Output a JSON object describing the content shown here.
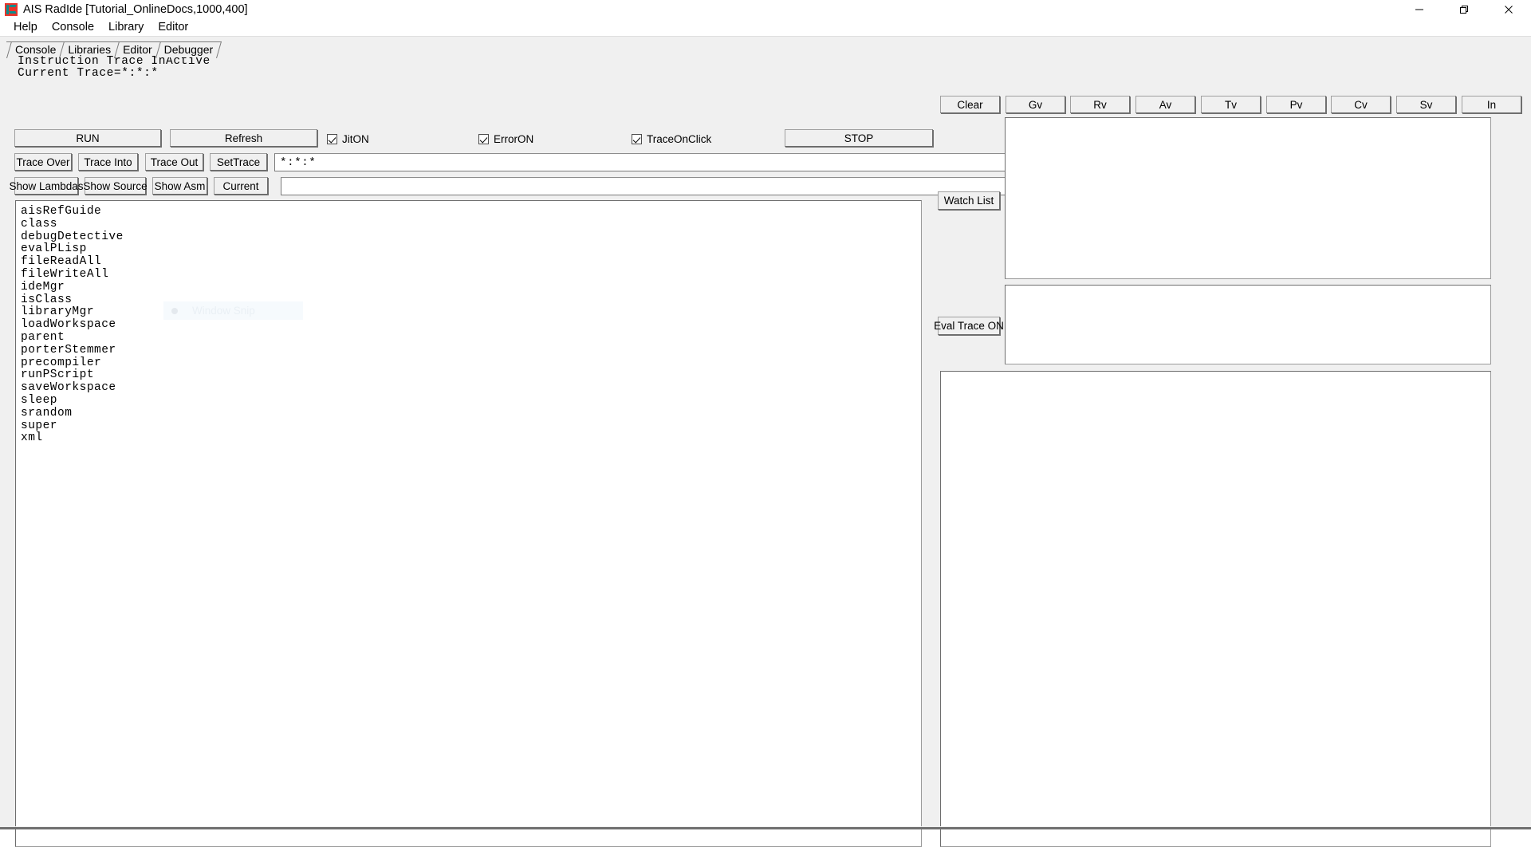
{
  "window": {
    "title": "AIS RadIde [Tutorial_OnlineDocs,1000,400]",
    "icon": "app-icon",
    "controls": {
      "minimize": "minimize-icon",
      "maximize": "maximize-icon",
      "close": "close-icon"
    }
  },
  "menubar": {
    "items": [
      {
        "label": "Help"
      },
      {
        "label": "Console"
      },
      {
        "label": "Library"
      },
      {
        "label": "Editor"
      }
    ]
  },
  "tabs": [
    {
      "label": "Console",
      "active": false
    },
    {
      "label": "Libraries",
      "active": false
    },
    {
      "label": "Editor",
      "active": false
    },
    {
      "label": "Debugger",
      "active": true
    }
  ],
  "status": {
    "trace_state": "Instruction Trace InActive",
    "current_trace": "Current Trace=*:*:*"
  },
  "toolbar_row1": {
    "run_label": "RUN",
    "refresh_label": "Refresh",
    "stop_label": "STOP",
    "checkboxes": [
      {
        "label": "JitON",
        "checked": true
      },
      {
        "label": "ErrorON",
        "checked": true
      },
      {
        "label": "TraceOnClick",
        "checked": true
      }
    ]
  },
  "toolbar_row2": {
    "trace_over_label": "Trace Over",
    "trace_into_label": "Trace Into",
    "trace_out_label": "Trace Out",
    "set_trace_label": "SetTrace",
    "trace_field_value": "*:*:*",
    "trace_field_placeholder": ""
  },
  "toolbar_row3": {
    "show_lambdas_label": "Show Lambdas",
    "show_source_label": "Show Source",
    "show_asm_label": "Show Asm",
    "current_label": "Current",
    "command_field_value": "",
    "command_field_placeholder": ""
  },
  "list_panel": {
    "items": [
      "aisRefGuide",
      "class",
      "debugDetective",
      "evalPLisp",
      "fileReadAll",
      "fileWriteAll",
      "ideMgr",
      "isClass",
      "libraryMgr",
      "loadWorkspace",
      "parent",
      "porterStemmer",
      "precompiler",
      "runPScript",
      "saveWorkspace",
      "sleep",
      "srandom",
      "super",
      "xml"
    ]
  },
  "right_toolbar": {
    "buttons": [
      {
        "label": "Clear"
      },
      {
        "label": "Gv"
      },
      {
        "label": "Rv"
      },
      {
        "label": "Av"
      },
      {
        "label": "Tv"
      },
      {
        "label": "Pv"
      },
      {
        "label": "Cv"
      },
      {
        "label": "Sv"
      },
      {
        "label": "In"
      }
    ]
  },
  "right_panels": {
    "watch_list_label": "Watch List",
    "watch_list_content": "",
    "eval_trace_label": "Eval Trace ON",
    "eval_trace_content": "",
    "output_content": ""
  },
  "overlay": {
    "ghost_label": "Window Snip"
  },
  "colors": {
    "window_bg": "#f0f0f0",
    "panel_bg": "#ffffff",
    "border": "#6e6e6e",
    "button_face": "#f0f0f0",
    "text": "#000000",
    "icon_red": "#e8342a",
    "icon_teal": "#0b8d8d"
  }
}
